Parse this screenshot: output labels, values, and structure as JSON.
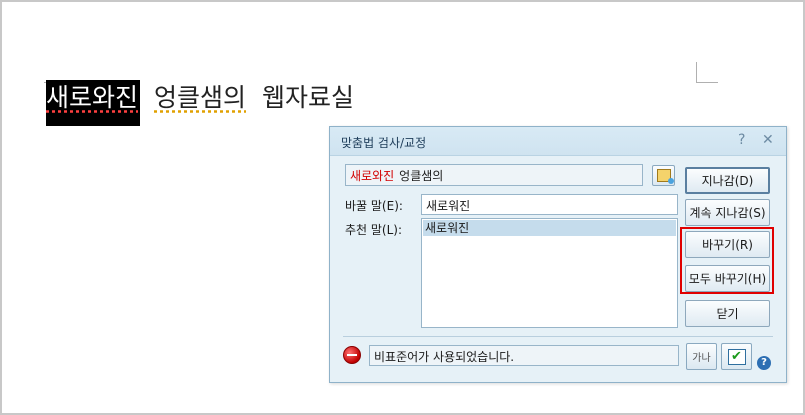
{
  "document": {
    "words": [
      "새로와진",
      "엉클샘의",
      "웹자료실"
    ]
  },
  "dialog": {
    "title": "맞춤법 검사/교정",
    "help_symbol": "?",
    "close_symbol": "✕",
    "context": {
      "error_word": "새로와진",
      "rest": "엉클샘의"
    },
    "replace_label": "바꿀 말(E):",
    "replace_value": "새로워진",
    "suggest_label": "추천 말(L):",
    "suggestions": [
      "새로워진"
    ],
    "buttons": {
      "skip": "지나감(D)",
      "skip_all": "계속 지나감(S)",
      "replace": "바꾸기(R)",
      "replace_all": "모두 바꾸기(H)",
      "close": "닫기"
    },
    "status_message": "비표준어가 사용되었습니다.",
    "tool_label": "가나",
    "check_symbol": "✔",
    "info_symbol": "?"
  },
  "colors": {
    "error_text": "#d20000",
    "highlight_border": "#e00000",
    "dialog_bg": "#e6f1f7"
  }
}
